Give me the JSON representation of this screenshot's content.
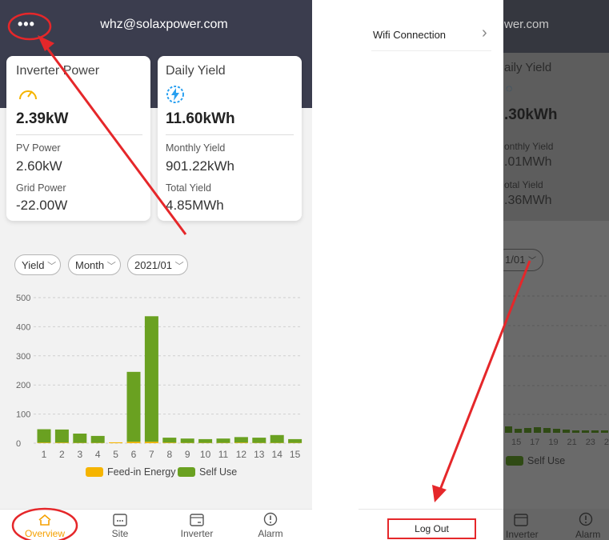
{
  "left": {
    "account_email": "whz@solaxpower.com",
    "menu_dots": "•••",
    "card_power": {
      "title": "Inverter Power",
      "value": "2.39kW",
      "pv_label": "PV Power",
      "pv_value": "2.60kW",
      "grid_label": "Grid Power",
      "grid_value": "-22.00W"
    },
    "card_yield": {
      "title": "Daily Yield",
      "value": "11.60kWh",
      "monthly_label": "Monthly Yield",
      "monthly_value": "901.22kWh",
      "total_label": "Total Yield",
      "total_value": "4.85MWh"
    },
    "filters": [
      "Yield",
      "Month",
      "2021/01"
    ],
    "legend": [
      "Feed-in Energy",
      "Self Use"
    ],
    "nav": [
      "Overview",
      "Site",
      "Inverter",
      "Alarm"
    ]
  },
  "chart_data": {
    "type": "bar",
    "stacked": true,
    "categories": [
      "1",
      "2",
      "3",
      "4",
      "5",
      "6",
      "7",
      "8",
      "9",
      "10",
      "11",
      "12",
      "13",
      "14",
      "15"
    ],
    "series": [
      {
        "name": "Feed-in Energy",
        "color": "#f5b400",
        "values": [
          2,
          2,
          1,
          1,
          3,
          5,
          5,
          2,
          1,
          1,
          1,
          2,
          1,
          1,
          1
        ]
      },
      {
        "name": "Self Use",
        "color": "#6aa121",
        "values": [
          46,
          45,
          32,
          24,
          0,
          240,
          431,
          17,
          15,
          13,
          15,
          19,
          18,
          27,
          13
        ]
      }
    ],
    "ylim": [
      0,
      500
    ],
    "yticks": [
      0,
      100,
      200,
      300,
      400,
      500
    ],
    "grid": true,
    "legend_position": "bottom"
  },
  "right": {
    "menu_item": "Wifi Connection",
    "chevron": "›",
    "logout": "Log Out",
    "bg_email": "wer.com",
    "bg_daily": "aily Yield",
    "bg_value": ".30kWh",
    "bg_monthly_label": "onthly Yield",
    "bg_monthly_value": ".01MWh",
    "bg_total_label": "otal Yield",
    "bg_total_value": ".36MWh",
    "bg_filter": "1/01",
    "bg_xlabels": [
      "15",
      "17",
      "19",
      "21",
      "23",
      "2"
    ],
    "bg_legend": "Self Use",
    "bg_nav": [
      "Inverter",
      "Alarm"
    ]
  }
}
